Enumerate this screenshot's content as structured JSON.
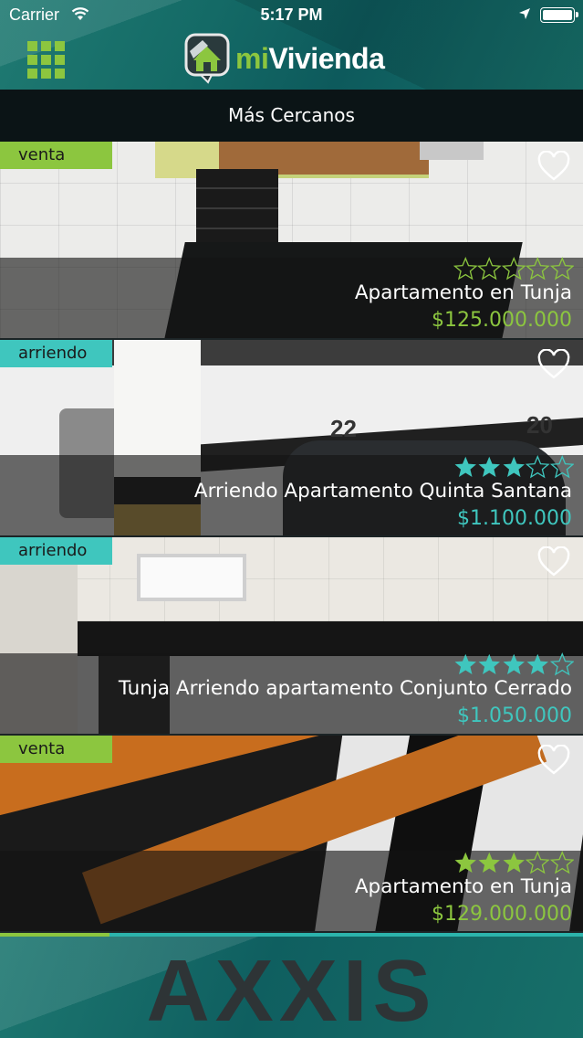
{
  "status_bar": {
    "carrier": "Carrier",
    "time": "5:17 PM"
  },
  "header": {
    "logo_prefix": "mi",
    "logo_name": "Vivienda",
    "menu_icon": "grid-menu-icon"
  },
  "section": {
    "title": "Más Cercanos"
  },
  "listings": [
    {
      "tag": "venta",
      "tag_type": "sale",
      "rating": 0,
      "rating_max": 5,
      "title": "Apartamento en Tunja",
      "price": "$125.000.000"
    },
    {
      "tag": "arriendo",
      "tag_type": "rent",
      "rating": 3,
      "rating_max": 5,
      "title": "Arriendo Apartamento Quinta Santana",
      "price": "$1.100.000"
    },
    {
      "tag": "arriendo",
      "tag_type": "rent",
      "rating": 4,
      "rating_max": 5,
      "title": "Tunja Arriendo apartamento Conjunto Cerrado",
      "price": "$1.050.000"
    },
    {
      "tag": "venta",
      "tag_type": "sale",
      "rating": 3,
      "rating_max": 5,
      "title": "Apartamento en Tunja",
      "price": "$129.000.000"
    }
  ],
  "banner": {
    "text": "AXXIS"
  },
  "colors": {
    "sale_green": "#8cc63f",
    "rent_teal": "#3fc6be",
    "header_teal": "#146a66",
    "section_bar": "#0b1416"
  }
}
